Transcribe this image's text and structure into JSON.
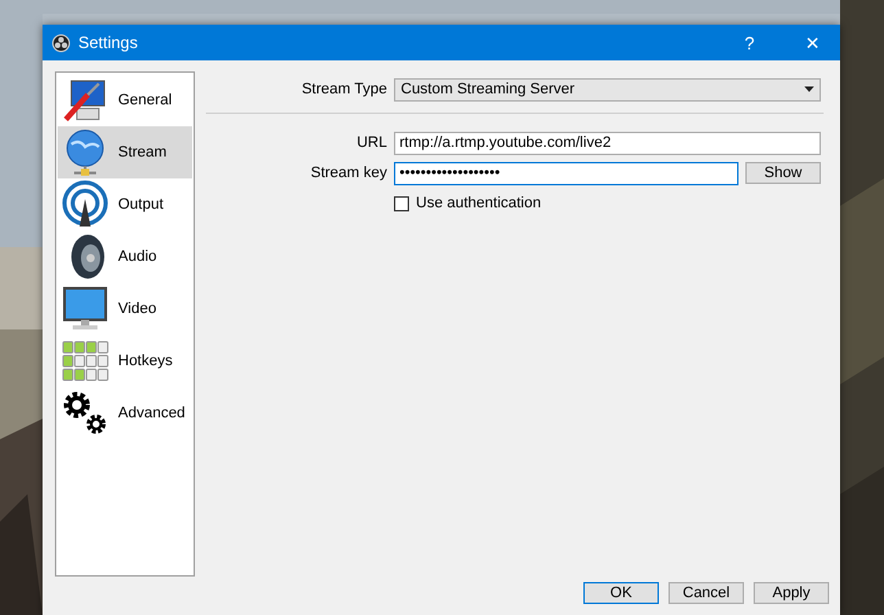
{
  "window": {
    "title": "Settings",
    "help_button": "?",
    "close_button": "✕"
  },
  "sidebar": {
    "items": [
      {
        "kind": "general",
        "label": "General",
        "selected": false
      },
      {
        "kind": "stream",
        "label": "Stream",
        "selected": true
      },
      {
        "kind": "output",
        "label": "Output",
        "selected": false
      },
      {
        "kind": "audio",
        "label": "Audio",
        "selected": false
      },
      {
        "kind": "video",
        "label": "Video",
        "selected": false
      },
      {
        "kind": "hotkeys",
        "label": "Hotkeys",
        "selected": false
      },
      {
        "kind": "advanced",
        "label": "Advanced",
        "selected": false
      }
    ]
  },
  "stream_type": {
    "label": "Stream Type",
    "value": "Custom Streaming Server"
  },
  "url": {
    "label": "URL",
    "value": "rtmp://a.rtmp.youtube.com/live2"
  },
  "stream_key": {
    "label": "Stream key",
    "value": "•••••••••••••••••••",
    "focused": true,
    "show_button": "Show"
  },
  "use_authentication": {
    "label": "Use authentication",
    "checked": false
  },
  "buttons": [
    {
      "label": "OK",
      "default": true
    },
    {
      "label": "Cancel",
      "default": false
    },
    {
      "label": "Apply",
      "default": false
    }
  ]
}
